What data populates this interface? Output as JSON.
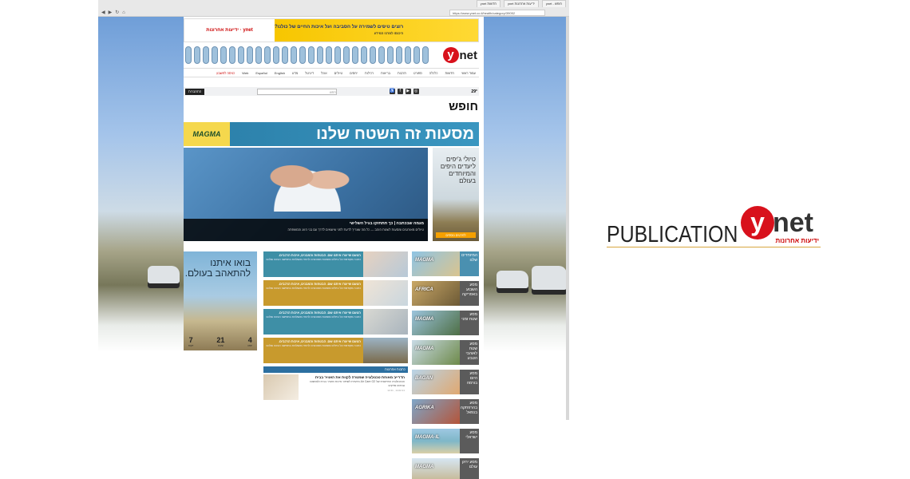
{
  "browser": {
    "tabs": [
      "ynet - חופש",
      "ynet ידיעות אחרונות",
      "ynet חדשות"
    ],
    "address": "https://www.ynet.co.il/health/category/39052"
  },
  "top_ad": {
    "headline": "רוצים טיפים לשמירה על הסביבה ועל איכות החיים של כולנו?",
    "sub": "היכנסו למרכז המידע",
    "brand": "ידיעות אחרונות · ynet"
  },
  "site": {
    "logo_y": "y",
    "logo_net": "net"
  },
  "nav": {
    "items": [
      "עמוד ראשי",
      "חדשות",
      "כלכלה",
      "ספורט",
      "תרבות",
      "בריאות",
      "רכילות",
      "יחסים",
      "טיולים",
      "אוכל",
      "דיגיטל",
      "מדע",
      "English",
      "Español",
      "Web"
    ],
    "login": "כניסה לחשבון"
  },
  "util": {
    "temperature": "29°",
    "search_placeholder": "חפש",
    "login_button": "התחברות"
  },
  "page_title": "חופש",
  "magma": {
    "logo": "MAGMA",
    "slogan": "מסעות זה השטח שלנו"
  },
  "hero": {
    "headline": "מגמה שבכתבה | כך תתחזקו בגיל השלישי",
    "text": "טיולים מאורגנים ומסעות לשנות הזהב — כל מה שצריך לדעת לפני שיוצאים לדרך עם בני הזוג והמשפחה"
  },
  "side_ad": {
    "text": "טיולי ג'יפים ליעדים היפים והמיוחדים בעולם",
    "cta": "לפרטים נוספים"
  },
  "travel_ad": {
    "slogan": "בואו איתנו להתאהב בעולם.",
    "countdown": [
      {
        "n": "4",
        "l": "ימים"
      },
      {
        "n": "21",
        "l": "שעות"
      },
      {
        "n": "7",
        "l": "דקות"
      }
    ]
  },
  "articles": [
    {
      "h": "הטעם שייצרו איתנו שם. הבטחות והמבנים, איכות הרכבים.",
      "t": "כתבה מקודמת על טיולים ומסעות מאורגנים לחוויה מושלמת בחופשה הבאה שלכם"
    },
    {
      "h": "הטעם שייצרו איתנו שם. הבטחות והמבנים, איכות הרכבים.",
      "t": "כתבה מקודמת על טיולים ומסעות מאורגנים לחוויה מושלמת בחופשה הבאה שלכם"
    },
    {
      "h": "הטעם שייצרו איתנו שם. הבטחות והמבנים, איכות הרכבים.",
      "t": "כתבה מקודמת על טיולים ומסעות מאורגנים לחוויה מושלמת בחופשה הבאה שלכם"
    },
    {
      "h": "הטעם שייצרו איתנו שם. הבטחות והמבנים, איכות הרכבים.",
      "t": "כתבה מקודמת על טיולים ומסעות מאורגנים לחוויה מושלמת בחופשה הבאה שלכם"
    }
  ],
  "section": {
    "head": "כתבות אחרונות",
    "news_headline": "הדרייב מאוחת טכנולוגיה שמטרה לקוות את האוויר בבית",
    "news_text": "הטכנולוגיה החדשנית של Air Care O2 מיועדת לשיפור איכות האוויר בבית ולצמצום גורמים מזיקים",
    "news_date": "14.02.21 , 12:41"
  },
  "trips": [
    {
      "brand": "MAGMA",
      "label": "המיוחדים שלנו"
    },
    {
      "brand": "AFRICA",
      "label": "מסע השבוע באפריקה"
    },
    {
      "brand": "MAGMA",
      "label": "מסע שטח זמני"
    },
    {
      "brand": "MAGMA",
      "label": "מסע שטח לאוהבי הטבע"
    },
    {
      "brand": "BAGAN",
      "label": "מסע היום בורמה"
    },
    {
      "brand": "AGRIKA",
      "label": "מסע בהרפתקה בנפאל"
    },
    {
      "brand": "MAGMA-IL",
      "label": "מסע ישראלי"
    },
    {
      "brand": "MAGMA",
      "label": "מסע ירוק עולם"
    }
  ],
  "publication": {
    "word": "PUBLICATION",
    "y": "y",
    "net": "net",
    "sub": "ידיעות אחרונות"
  },
  "colors": {
    "ynet_red": "#d8111c",
    "magma_blue": "#2a7ea8",
    "teal": "#3e8fa6",
    "gold": "#c89a2d"
  }
}
